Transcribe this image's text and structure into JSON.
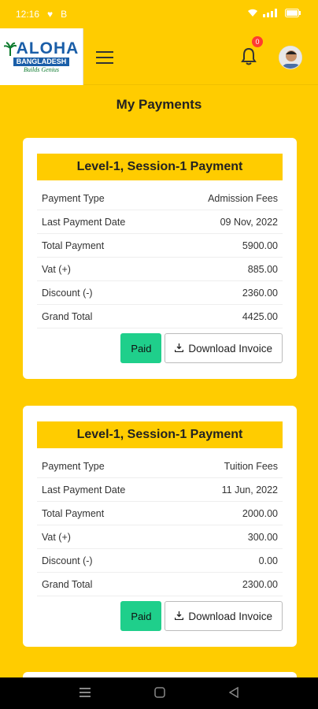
{
  "status_bar": {
    "time": "12:16",
    "heart_icon": "heart-icon",
    "b_label": "B"
  },
  "header": {
    "logo_main": "ALOHA",
    "logo_sub": "BANGLADESH",
    "logo_tag": "Builds Genius",
    "notification_count": "0"
  },
  "page": {
    "title": "My Payments"
  },
  "cards": [
    {
      "heading": "Level-1, Session-1 Payment",
      "rows": [
        {
          "label": "Payment Type",
          "value": "Admission Fees"
        },
        {
          "label": "Last Payment Date",
          "value": "09 Nov, 2022"
        },
        {
          "label": "Total Payment",
          "value": "5900.00"
        },
        {
          "label": "Vat (+)",
          "value": "885.00"
        },
        {
          "label": "Discount (-)",
          "value": "2360.00"
        },
        {
          "label": "Grand Total",
          "value": "4425.00"
        }
      ],
      "status_label": "Paid",
      "invoice_label": "Download Invoice"
    },
    {
      "heading": "Level-1, Session-1 Payment",
      "rows": [
        {
          "label": "Payment Type",
          "value": "Tuition Fees"
        },
        {
          "label": "Last Payment Date",
          "value": "11 Jun, 2022"
        },
        {
          "label": "Total Payment",
          "value": "2000.00"
        },
        {
          "label": "Vat (+)",
          "value": "300.00"
        },
        {
          "label": "Discount (-)",
          "value": "0.00"
        },
        {
          "label": "Grand Total",
          "value": "2300.00"
        }
      ],
      "status_label": "Paid",
      "invoice_label": "Download Invoice"
    }
  ],
  "colors": {
    "accent": "#FFCC00",
    "paid": "#1fcf8b",
    "logo_blue": "#1a5ea8"
  }
}
